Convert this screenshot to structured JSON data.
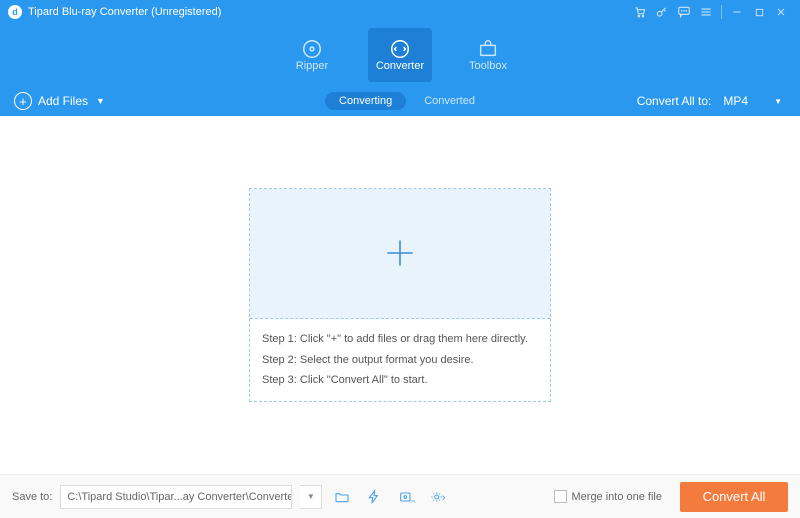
{
  "titlebar": {
    "title": "Tipard Blu-ray Converter (Unregistered)"
  },
  "nav": {
    "ripper": "Ripper",
    "converter": "Converter",
    "toolbox": "Toolbox"
  },
  "toolbar": {
    "add_files": "Add Files",
    "converting": "Converting",
    "converted": "Converted",
    "convert_all_to": "Convert All to:",
    "format": "MP4"
  },
  "steps": {
    "s1": "Step 1: Click \"+\" to add files or drag them here directly.",
    "s2": "Step 2: Select the output format you desire.",
    "s3": "Step 3: Click \"Convert All\" to start."
  },
  "footer": {
    "save_to": "Save to:",
    "path": "C:\\Tipard Studio\\Tipar...ay Converter\\Converted",
    "merge": "Merge into one file",
    "convert_all": "Convert All"
  }
}
